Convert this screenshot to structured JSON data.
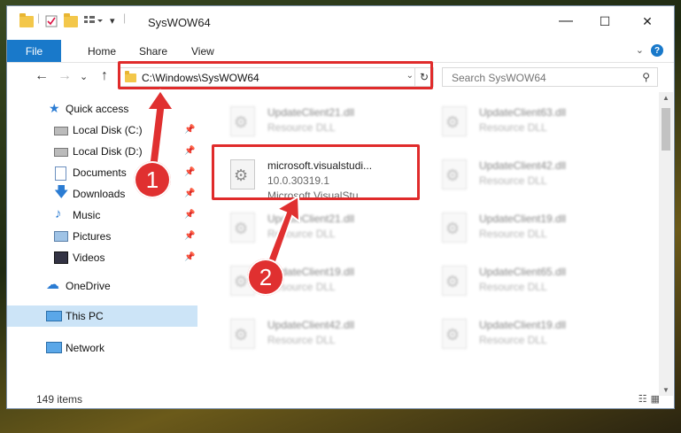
{
  "window": {
    "title": "SysWOW64",
    "controls": {
      "minimize": "—",
      "maximize": "☐",
      "close": "✕"
    }
  },
  "ribbon": {
    "file": "File",
    "tabs": [
      "Home",
      "Share",
      "View"
    ],
    "help": "?",
    "collapse": "⌄"
  },
  "nav": {
    "back": "←",
    "forward": "→",
    "recent": "⌄",
    "up": "↑",
    "address": "C:\\Windows\\SysWOW64",
    "address_dropdown": "⌄",
    "refresh": "↻",
    "search_placeholder": "Search SysWOW64",
    "search_icon": "⚲"
  },
  "sidebar": {
    "items": [
      {
        "label": "Quick access",
        "icon": "star-icon"
      },
      {
        "label": "Local Disk (C:)",
        "icon": "drive-icon",
        "pin": true
      },
      {
        "label": "Local Disk (D:)",
        "icon": "drive-icon",
        "pin": true
      },
      {
        "label": "Documents",
        "icon": "documents-icon",
        "pin": true
      },
      {
        "label": "Downloads",
        "icon": "download-icon",
        "pin": true
      },
      {
        "label": "Music",
        "icon": "music-icon",
        "pin": true
      },
      {
        "label": "Pictures",
        "icon": "pictures-icon",
        "pin": true
      },
      {
        "label": "Videos",
        "icon": "videos-icon",
        "pin": true
      },
      {
        "label": "OneDrive",
        "icon": "cloud-icon"
      },
      {
        "label": "This PC",
        "icon": "computer-icon",
        "selected": true
      },
      {
        "label": "Network",
        "icon": "network-icon"
      }
    ]
  },
  "files": {
    "col1": [
      {
        "name": "UpdateClient21.dll",
        "type": "Resource DLL"
      },
      {
        "name": "microsoft.visualstudi...",
        "version": "10.0.30319.1",
        "desc": "Microsoft.VisualStu..."
      },
      {
        "name": "UpdateClient21.dll",
        "type": "Resource DLL"
      },
      {
        "name": "UpdateClient19.dll",
        "type": "Resource DLL"
      },
      {
        "name": "UpdateClient42.dll",
        "type": "Resource DLL"
      }
    ],
    "col2": [
      {
        "name": "UpdateClient63.dll",
        "type": "Resource DLL"
      },
      {
        "name": "UpdateClient42.dll",
        "type": "Resource DLL"
      },
      {
        "name": "UpdateClient19.dll",
        "type": "Resource DLL"
      },
      {
        "name": "UpdateClient65.dll",
        "type": "Resource DLL"
      },
      {
        "name": "UpdateClient19.dll",
        "type": "Resource DLL"
      }
    ]
  },
  "status": {
    "count": "149 items"
  },
  "annotations": {
    "badge1": "1",
    "badge2": "2",
    "color": "#e02b2b"
  }
}
